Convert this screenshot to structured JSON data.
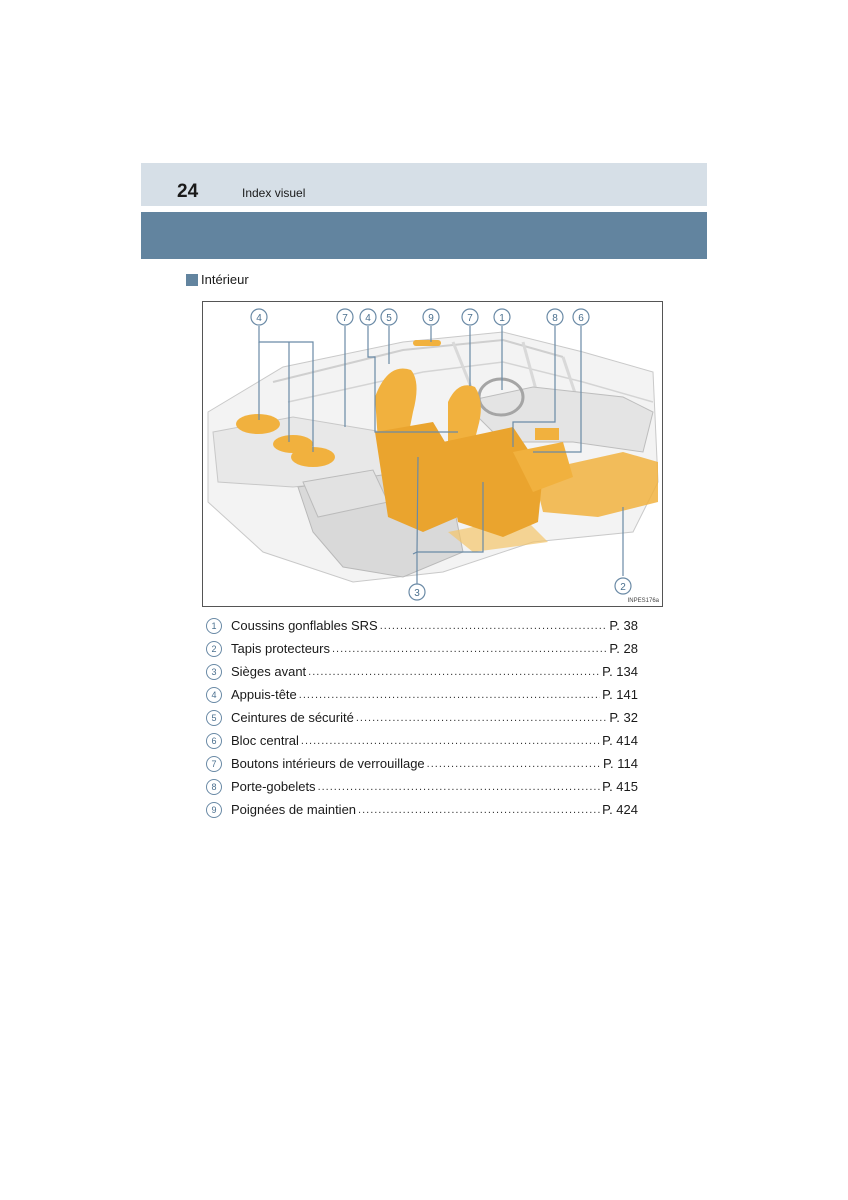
{
  "header": {
    "page_number": "24",
    "section": "Index visuel"
  },
  "subhead": {
    "label": "Intérieur"
  },
  "figure": {
    "code": "INPES176a"
  },
  "callouts": [
    "1",
    "2",
    "3",
    "4",
    "5",
    "6",
    "7",
    "8",
    "9"
  ],
  "colors": {
    "accent": "#62849f",
    "header_band": "#d6dfe7",
    "highlight": "#f1b13e"
  },
  "legend": [
    {
      "num": "1",
      "label": "Coussins gonflables SRS",
      "page": "P. 38"
    },
    {
      "num": "2",
      "label": "Tapis protecteurs",
      "page": "P. 28"
    },
    {
      "num": "3",
      "label": "Sièges avant",
      "page": "P. 134"
    },
    {
      "num": "4",
      "label": "Appuis-tête",
      "page": "P. 141"
    },
    {
      "num": "5",
      "label": "Ceintures de sécurité",
      "page": "P. 32"
    },
    {
      "num": "6",
      "label": "Bloc central",
      "page": "P. 414"
    },
    {
      "num": "7",
      "label": "Boutons intérieurs de verrouillage",
      "page": "P. 114"
    },
    {
      "num": "8",
      "label": "Porte-gobelets",
      "page": "P. 415"
    },
    {
      "num": "9",
      "label": "Poignées de maintien",
      "page": "P. 424"
    }
  ]
}
